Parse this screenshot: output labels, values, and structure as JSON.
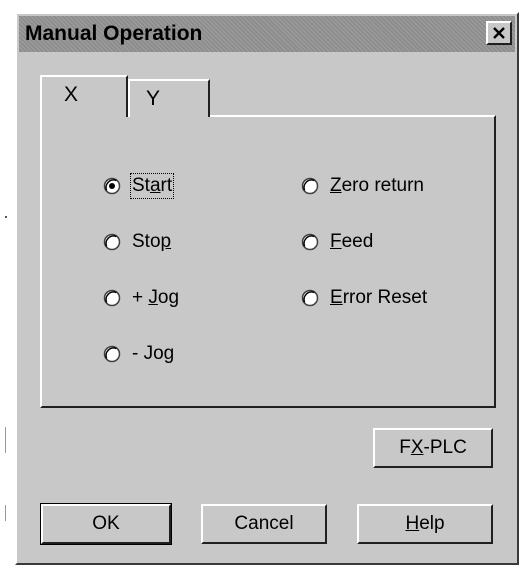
{
  "window": {
    "title": "Manual Operation",
    "close_symbol": "✕"
  },
  "tabs": [
    {
      "label": "X",
      "selected": true
    },
    {
      "label": "Y",
      "selected": false
    }
  ],
  "radios_left": [
    {
      "label": "Start",
      "checked": true
    },
    {
      "label": "Stop",
      "checked": false
    },
    {
      "label": "+ Jog",
      "checked": false
    },
    {
      "label": "- Jog",
      "checked": false
    }
  ],
  "radios_right": [
    {
      "label": "Zero return",
      "checked": false
    },
    {
      "label": "Feed",
      "checked": false
    },
    {
      "label": "Error Reset",
      "checked": false
    }
  ],
  "buttons": {
    "fx_plc": "FX-PLC",
    "ok": "OK",
    "cancel": "Cancel",
    "help": "Help"
  },
  "colors": {
    "face": "#c8c8c8",
    "titlebar": "#8d8d8d",
    "highlight": "#ffffff",
    "shadow": "#202020"
  }
}
